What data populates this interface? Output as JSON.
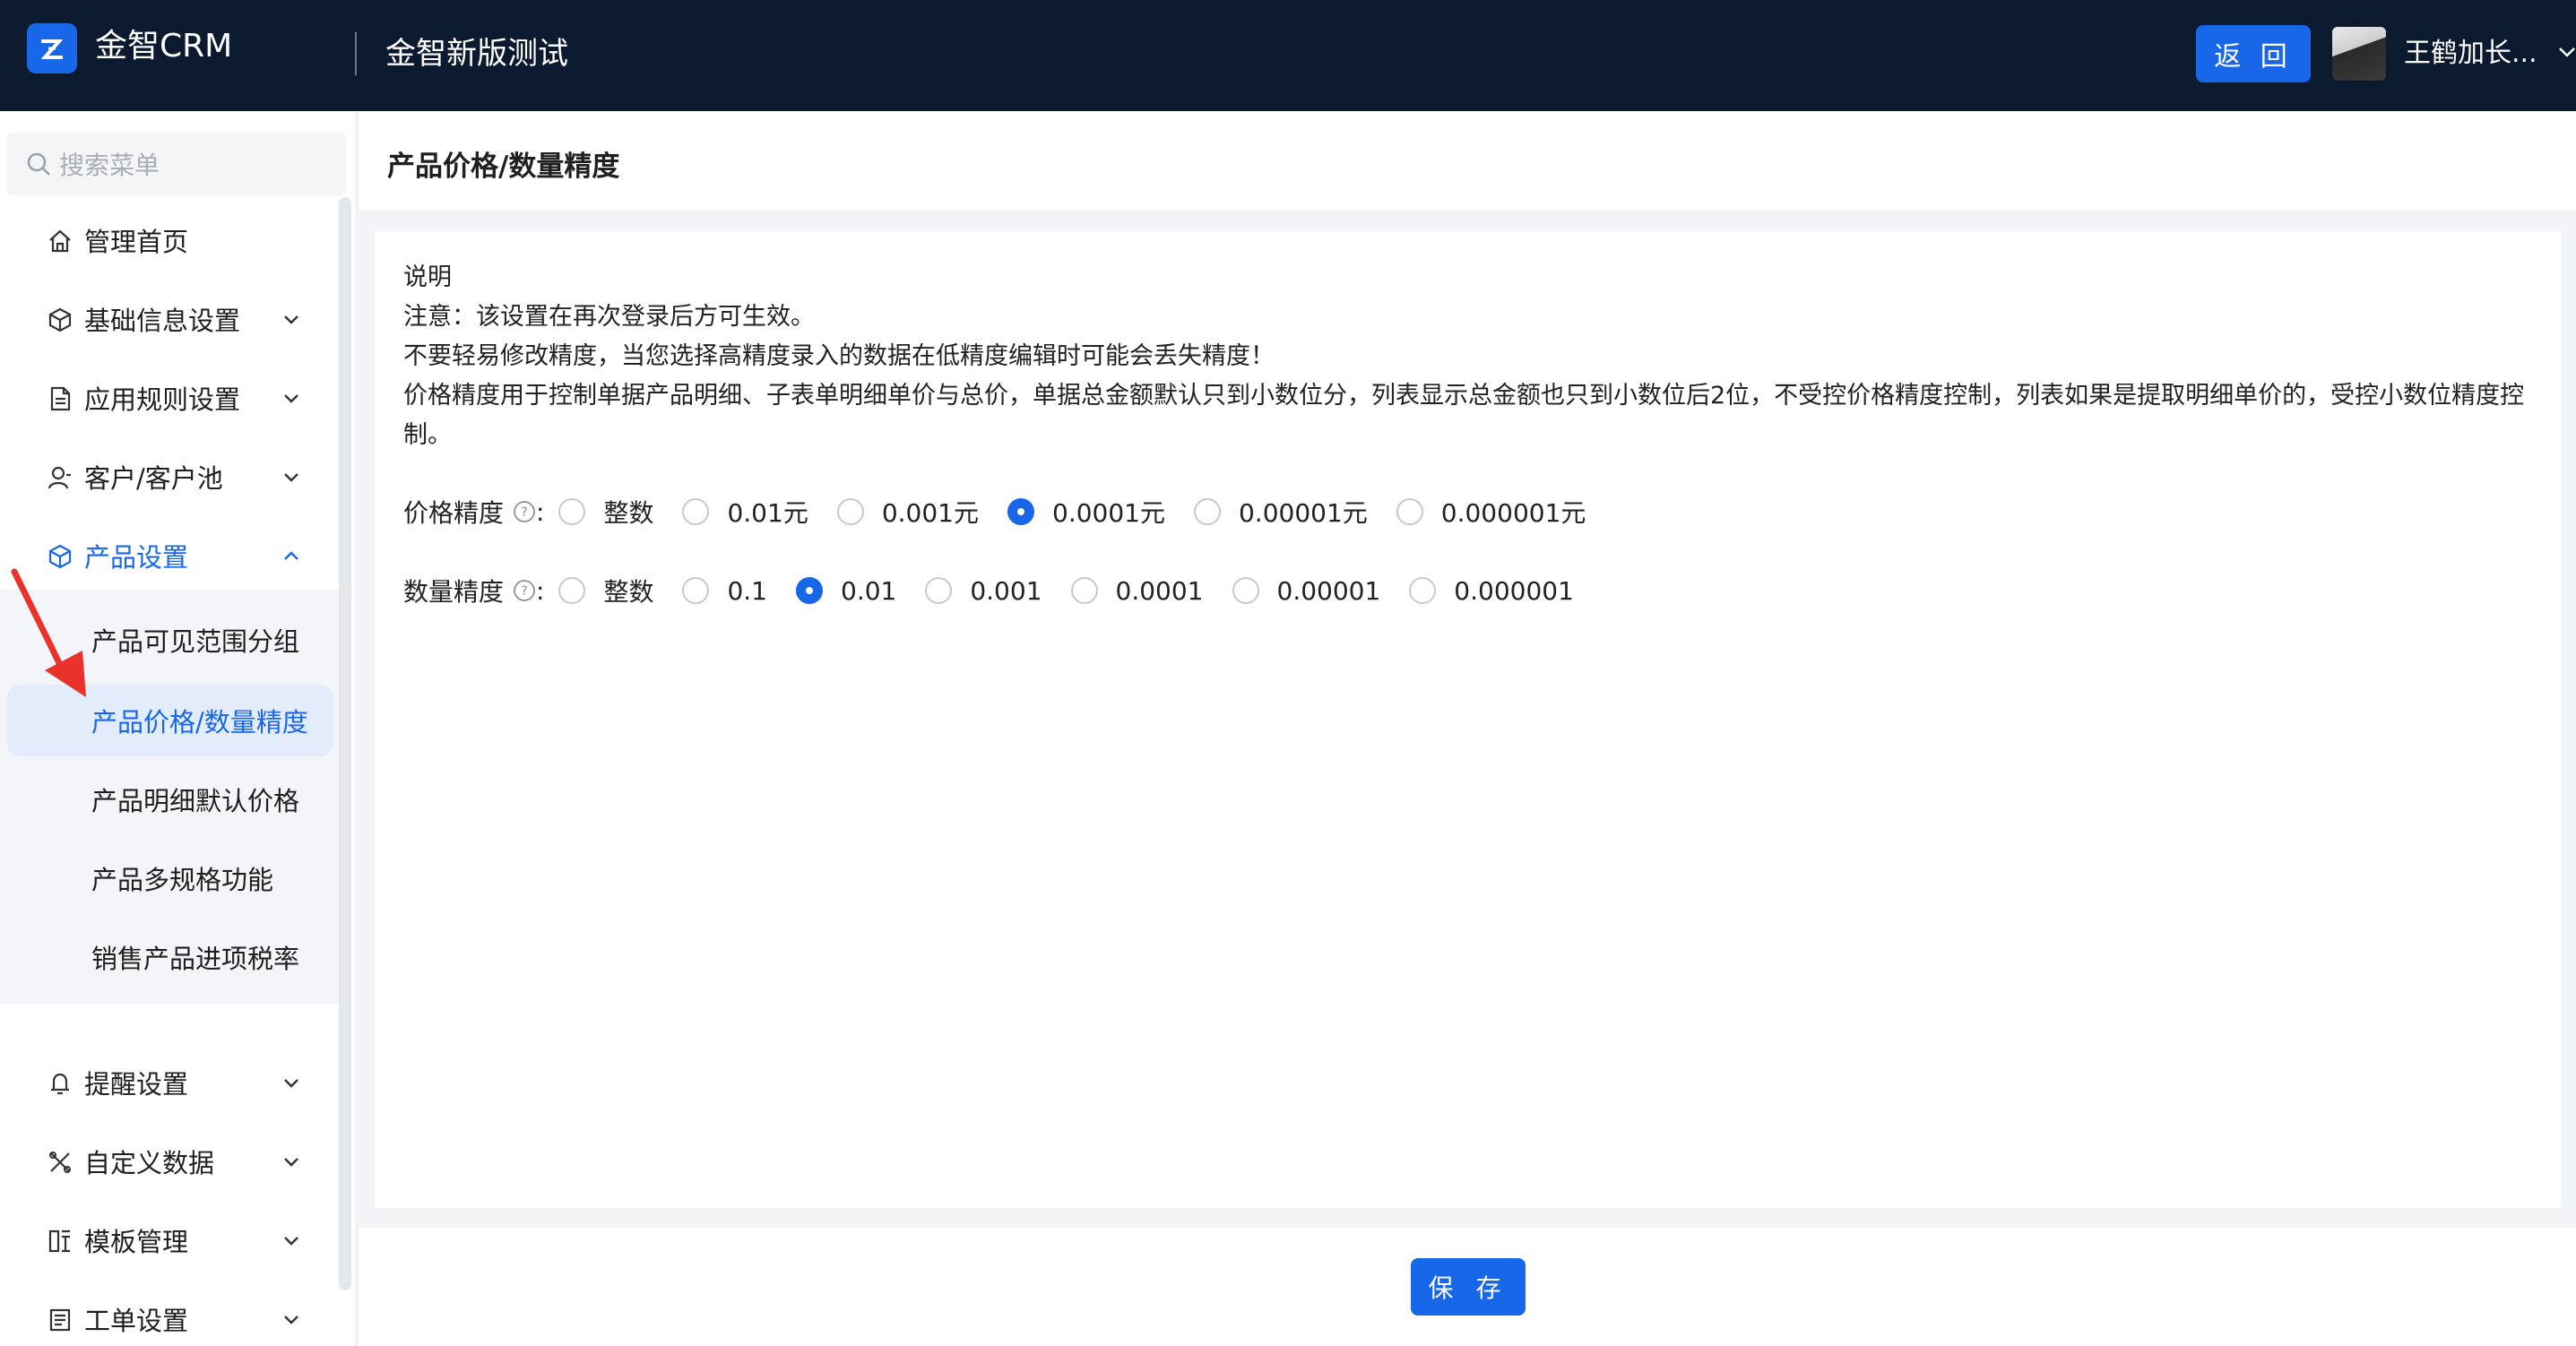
{
  "header": {
    "brand": "金智CRM",
    "org_name": "金智新版测试",
    "back_label": "返 回",
    "username": "王鹤加长..."
  },
  "sidebar": {
    "search_placeholder": "搜索菜单",
    "items": [
      {
        "label": "管理首页",
        "icon": "home-icon",
        "expandable": false
      },
      {
        "label": "基础信息设置",
        "icon": "cube-icon",
        "expandable": true
      },
      {
        "label": "应用规则设置",
        "icon": "document-icon",
        "expandable": true
      },
      {
        "label": "客户/客户池",
        "icon": "customer-icon",
        "expandable": true
      },
      {
        "label": "产品设置",
        "icon": "cube-icon",
        "expandable": true,
        "expanded": true
      },
      {
        "label": "提醒设置",
        "icon": "bell-icon",
        "expandable": true
      },
      {
        "label": "自定义数据",
        "icon": "tools-icon",
        "expandable": true
      },
      {
        "label": "模板管理",
        "icon": "template-icon",
        "expandable": true
      },
      {
        "label": "工单设置",
        "icon": "ticket-icon",
        "expandable": true
      }
    ],
    "product_sub_items": [
      {
        "label": "产品可见范围分组"
      },
      {
        "label": "产品价格/数量精度",
        "selected": true
      },
      {
        "label": "产品明细默认价格"
      },
      {
        "label": "产品多规格功能"
      },
      {
        "label": "销售产品进项税率"
      }
    ]
  },
  "main": {
    "title": "产品价格/数量精度",
    "description": [
      "说明",
      "注意：该设置在再次登录后方可生效。",
      "不要轻易修改精度，当您选择高精度录入的数据在低精度编辑时可能会丢失精度！",
      "价格精度用于控制单据产品明细、子表单明细单价与总价，单据总金额默认只到小数位分，列表显示总金额也只到小数位后2位，不受控价格精度控制，列表如果是提取明细单价的，受控小数位精度控制。"
    ],
    "price_precision": {
      "label": "价格精度",
      "options": [
        "整数",
        "0.01元",
        "0.001元",
        "0.0001元",
        "0.00001元",
        "0.000001元"
      ],
      "selected": "0.0001元"
    },
    "quantity_precision": {
      "label": "数量精度",
      "options": [
        "整数",
        "0.1",
        "0.01",
        "0.001",
        "0.0001",
        "0.00001",
        "0.000001"
      ],
      "selected": "0.01"
    },
    "save_label": "保 存"
  },
  "colors": {
    "header_bg": "#0b1a2e",
    "accent": "#1767e8",
    "annotation_arrow": "#e8322b"
  }
}
